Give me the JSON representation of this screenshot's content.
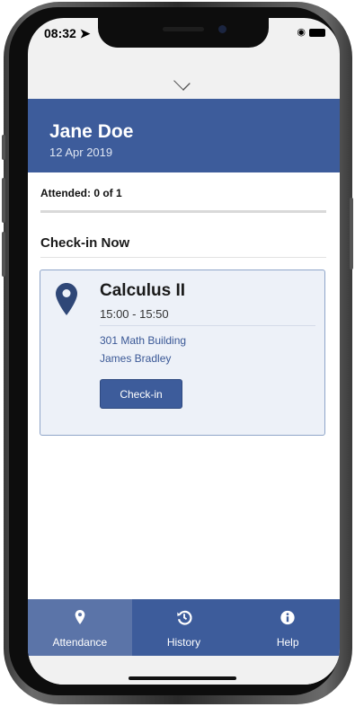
{
  "status_bar": {
    "time": "08:32"
  },
  "header": {
    "name": "Jane Doe",
    "date": "12 Apr 2019"
  },
  "attendance": {
    "label": "Attended: 0 of 1",
    "progress_fraction": 0
  },
  "section": {
    "title": "Check-in Now"
  },
  "class_card": {
    "course": "Calculus II",
    "time": "15:00 - 15:50",
    "location": "301 Math Building",
    "teacher": "James Bradley",
    "button_label": "Check-in",
    "icon": "map-pin-icon"
  },
  "tabs": [
    {
      "label": "Attendance",
      "icon": "map-pin-icon",
      "active": true
    },
    {
      "label": "History",
      "icon": "history-icon",
      "active": false
    },
    {
      "label": "Help",
      "icon": "info-icon",
      "active": false
    }
  ],
  "colors": {
    "primary": "#3d5c9b",
    "active_tab": "#5b74a8",
    "card_bg": "#edf1f8",
    "link": "#3a5896"
  }
}
